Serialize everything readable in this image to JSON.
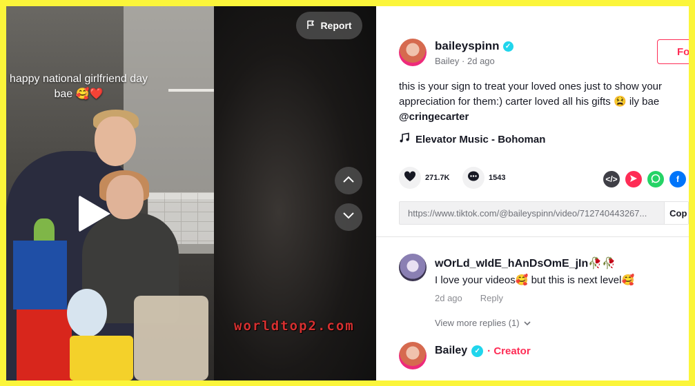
{
  "video": {
    "caption": "happy national girlfriend day bae 🥰❤️",
    "report_label": "Report",
    "watermark": "worldtop2.com"
  },
  "post": {
    "username": "baileyspinn",
    "display_name": "Bailey",
    "time_ago": "2d ago",
    "follow_label": "Fo",
    "description": "this is your sign to treat your loved ones just to show your appreciation for them:) carter loved all his gifts 😫 ily bae",
    "mention": "@cringecarter",
    "music": "Elevator Music - Bohoman",
    "likes": "271.7K",
    "comments_count": "1543",
    "link": "https://www.tiktok.com/@baileyspinn/video/712740443267...",
    "copy_label": "Cop"
  },
  "comments": [
    {
      "author": "wOrLd_wIdE_hAnDsOmE_jIn🥀🥀",
      "text": "I love your videos🥰 but this is next level🥰",
      "time_ago": "2d ago",
      "reply_label": "Reply",
      "more_replies": "View more replies (1)"
    }
  ],
  "reply": {
    "author": "Bailey",
    "separator": "·",
    "badge": "Creator"
  },
  "colors": {
    "accent": "#fe2c55",
    "verified": "#20d5ec",
    "border_frame": "#fbf53a",
    "watermark": "#d63030"
  },
  "icons": [
    "flag-icon",
    "play-icon",
    "chevron-up-icon",
    "chevron-down-icon",
    "verified-icon",
    "music-note-icon",
    "heart-icon",
    "comment-icon",
    "embed-icon",
    "send-icon",
    "whatsapp-icon",
    "facebook-icon"
  ]
}
